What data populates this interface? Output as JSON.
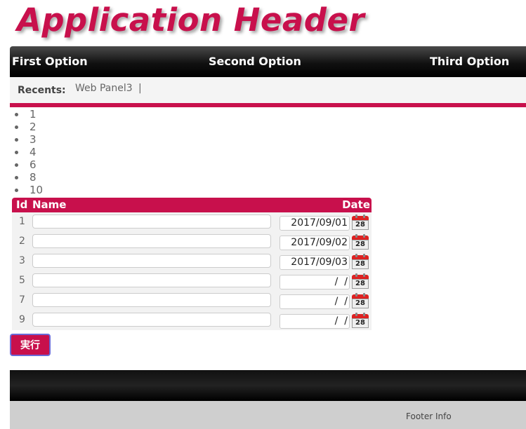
{
  "header": {
    "title": "Application Header"
  },
  "nav": {
    "items": [
      "First Option",
      "Second Option",
      "Third Option"
    ]
  },
  "recents": {
    "label": "Recents:",
    "link": "Web Panel3",
    "separator": "|"
  },
  "numbers": [
    "1",
    "2",
    "3",
    "4",
    "6",
    "8",
    "10"
  ],
  "grid": {
    "headers": {
      "id": "Id",
      "name": "Name",
      "date": "Date"
    },
    "rows": [
      {
        "id": "1",
        "name": "",
        "date": "2017/09/01"
      },
      {
        "id": "2",
        "name": "",
        "date": "2017/09/02"
      },
      {
        "id": "3",
        "name": "",
        "date": "2017/09/03"
      },
      {
        "id": "5",
        "name": "",
        "date": "  /  /"
      },
      {
        "id": "7",
        "name": "",
        "date": "  /  /"
      },
      {
        "id": "9",
        "name": "",
        "date": "  /  /"
      }
    ],
    "calendar_icon_day": "28"
  },
  "actions": {
    "execute_label": "実行"
  },
  "footer": {
    "info": "Footer Info"
  },
  "colors": {
    "accent": "#c8104c",
    "nav_bg": "#000000",
    "recents_bg": "#f4f4f4",
    "footer_info_bg": "#cfcfcf"
  }
}
